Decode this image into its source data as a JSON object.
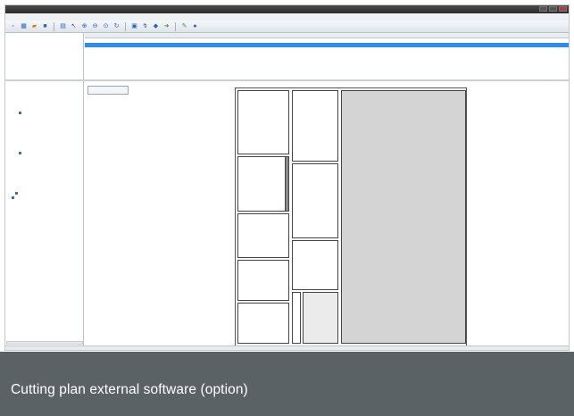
{
  "caption": "Cutting plan external software (option)",
  "colors": {
    "caption_bg": "#5b6266",
    "selection": "#2e8be6",
    "waste_block": "#d4d4d4"
  },
  "icons": [
    "new-icon",
    "grid-icon",
    "open-icon",
    "save-icon",
    "print-icon",
    "cursor-icon",
    "zoom-in-icon",
    "zoom-out-icon",
    "zoom-fit-icon",
    "refresh-icon",
    "layout-icon",
    "optimize-icon",
    "color-icon",
    "export-icon",
    "settings-icon",
    "help-icon"
  ]
}
